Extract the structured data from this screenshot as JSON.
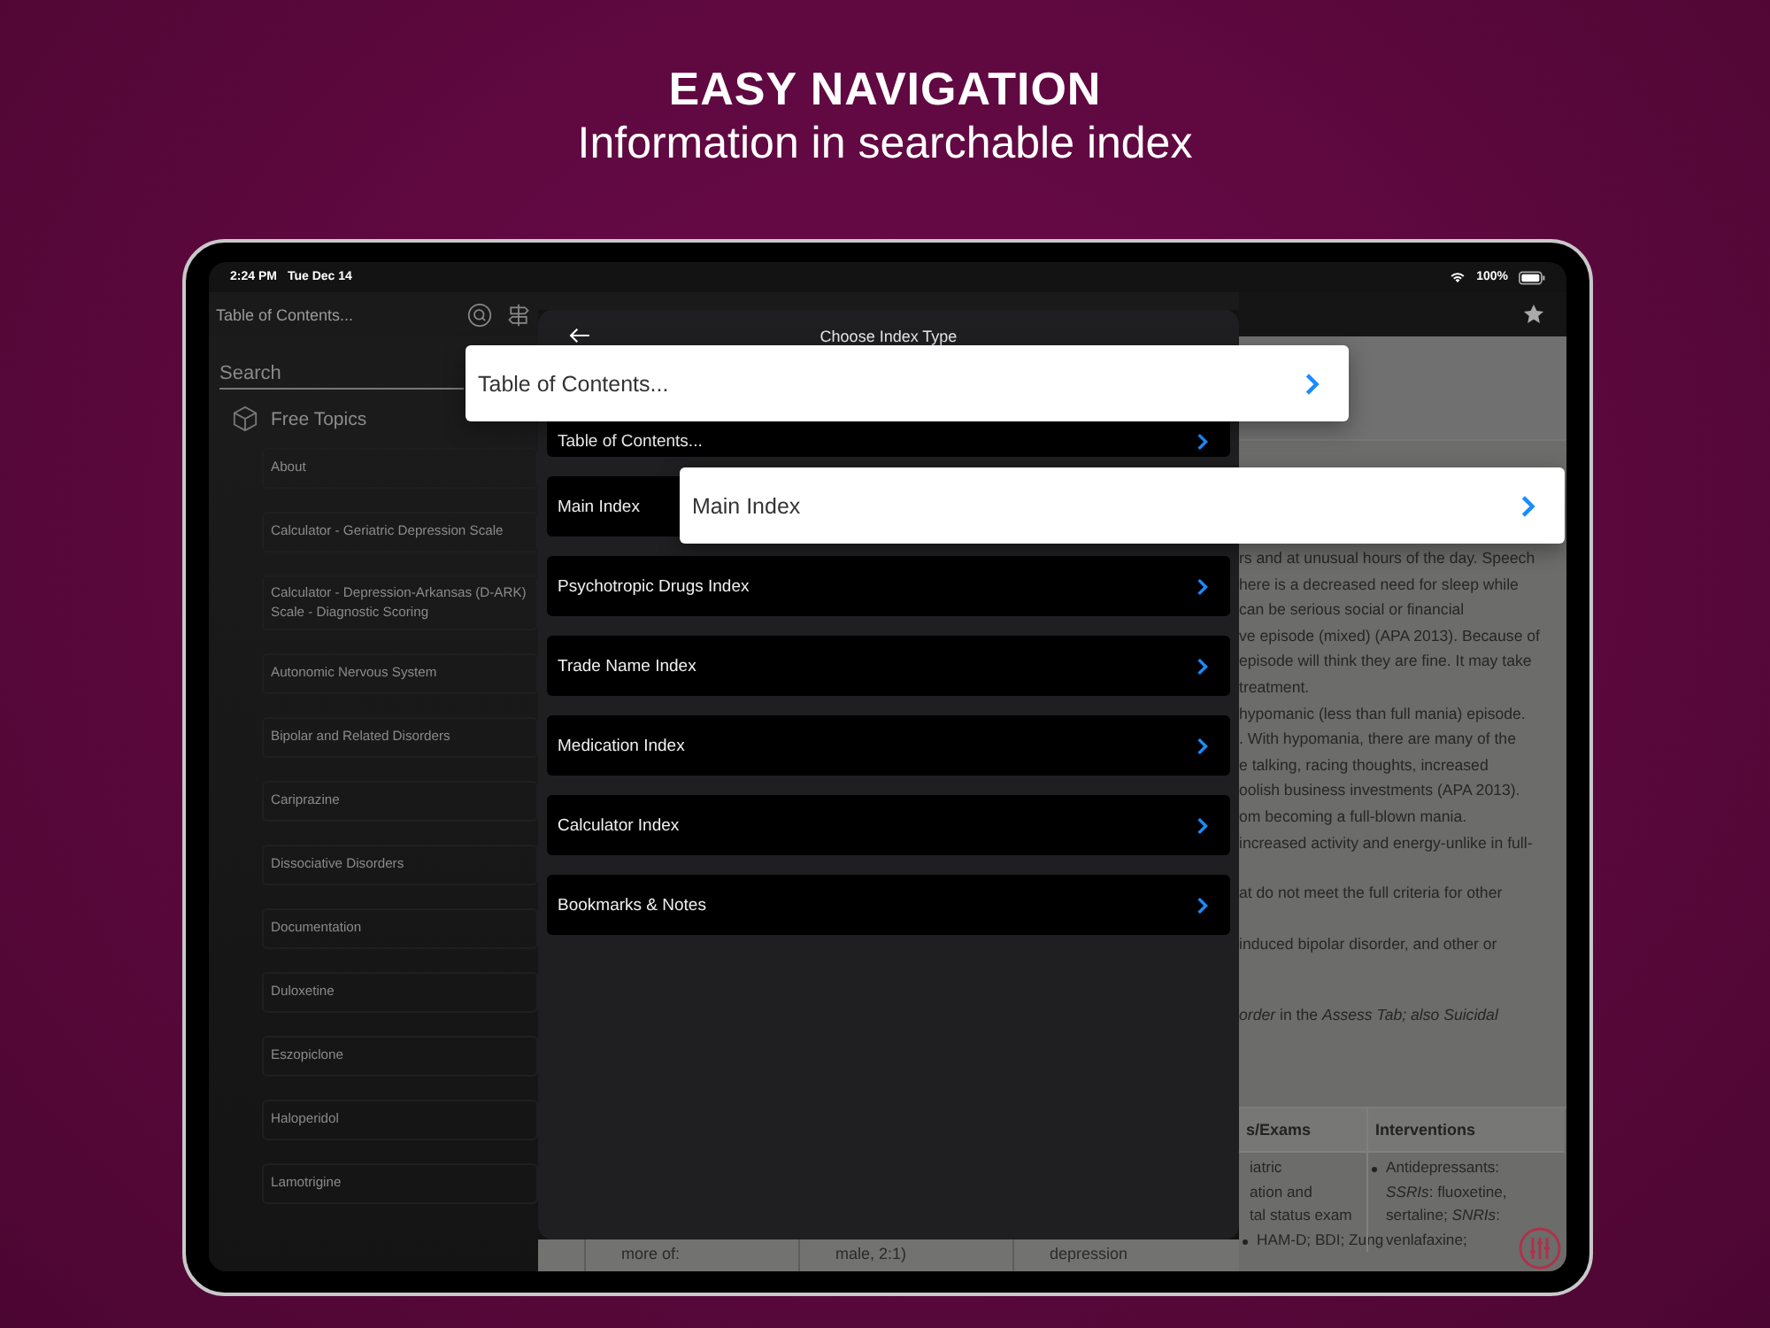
{
  "headline": {
    "title": "EASY NAVIGATION",
    "subtitle": "Information in searchable index"
  },
  "status_bar": {
    "time": "2:24 PM",
    "date": "Tue Dec 14",
    "battery": "100%"
  },
  "sidebar": {
    "title": "Table of Contents...",
    "search": {
      "placeholder": "Search"
    },
    "section": "Free Topics",
    "items": [
      "About",
      "Calculator - Geriatric Depression Scale",
      "Calculator - Depression-Arkansas (D-ARK) Scale - Diagnostic Scoring",
      "Autonomic Nervous System",
      "Bipolar and Related Disorders",
      "Cariprazine",
      "Dissociative Disorders",
      "Documentation",
      "Duloxetine",
      "Eszopiclone",
      "Haloperidol",
      "Lamotrigine"
    ]
  },
  "index_menu": {
    "title": "Choose Index Type",
    "items": [
      {
        "label": "Table of Contents..."
      },
      {
        "label": "Main Index"
      },
      {
        "label": "Psychotropic Drugs Index"
      },
      {
        "label": "Trade Name Index"
      },
      {
        "label": "Medication Index"
      },
      {
        "label": "Calculator Index"
      },
      {
        "label": "Bookmarks & Notes"
      }
    ]
  },
  "callouts": [
    {
      "label": "Table of Contents..."
    },
    {
      "label": "Main Index"
    }
  ],
  "article": {
    "paragraphs": [
      [
        "rs and at unusual hours of the day. Speech",
        "here is a decreased need for sleep while",
        "can be serious social or financial",
        "ve episode (mixed) (APA 2013). Because of",
        "episode will think they are fine. It may take",
        "treatment.",
        "hypomanic (less than full mania) episode.",
        ". With hypomania, there are many of the",
        "e talking, racing thoughts, increased",
        "oolish business investments (APA 2013).",
        "om becoming a full-blown mania.",
        "increased activity and energy-unlike in full-"
      ],
      [
        "at do not meet the full criteria for other"
      ],
      [
        "induced bipolar disorder, and other or"
      ],
      [
        "*order* in the *Assess Tab; also Suicidal*"
      ]
    ],
    "table": {
      "columns": [
        "s/Exams",
        "Interventions"
      ],
      "column_1_lines": [
        "iatric",
        "ation and",
        "tal status exam"
      ],
      "column_1_bullet": "HAM-D; BDI; Zung",
      "column_2_bullet": "Antidepressants: *SSRIs*: fluoxetine, sertaline; *SNRIs*: venlafaxine;"
    },
    "bottom_cells": [
      "more of:",
      "male, 2:1)",
      "depression"
    ]
  }
}
